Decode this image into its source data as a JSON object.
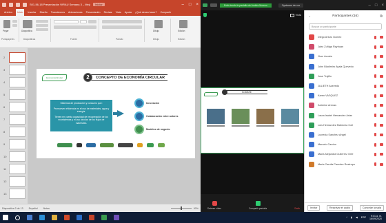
{
  "powerpoint": {
    "filename": "S01-56-18 Presentación WRAU Semana 3 – Mejor solo",
    "badge": "Iniciar",
    "tabs": [
      "Archivo",
      "Inicio",
      "Insertar",
      "Diseño",
      "Transiciones",
      "Animaciones",
      "Presentación",
      "Revisar",
      "Vista",
      "Ayuda",
      "¿Qué desea hacer?",
      "Compartir"
    ],
    "ribbon_groups": [
      "Portapapeles",
      "Diapositivas",
      "Fuente",
      "Párrafo",
      "Dibujo",
      "Edición"
    ],
    "ribbon_buttons": {
      "paste": "Pegar",
      "new_slide": "Diapositiva",
      "draw": "Dibujo",
      "edit": "Edición"
    },
    "slide_numbers": [
      "2",
      "3",
      "4",
      "5",
      "6",
      "7",
      "8",
      "9",
      "10",
      "11",
      "12",
      "13"
    ],
    "selected_slide": "2",
    "status": {
      "slide_info": "Diapositiva 2 de 13",
      "language": "Español",
      "notes": "Notas",
      "zoom": "90%"
    }
  },
  "slide": {
    "number": "2",
    "title": "CONCEPTO DE ECONOMÍA CIRCULAR",
    "logo_text": "EconomíaCircular",
    "box_paragraphs": [
      "Sistemas de producción y consumo que:",
      "Promueven eficiencia en el uso de materiales, agua y energía.",
      "Tienen en cuenta capacidad de recuperación de los ecosistemas y el uso circular de los flujos de materiales."
    ],
    "items": [
      "Innovación",
      "Colaboración entre actores",
      "Modelos de negocio"
    ],
    "logos": [
      "MINAMBIENTE",
      "Gobierno",
      "ANDI",
      "CECODES",
      "adidas",
      "Estrella",
      "Logo 7",
      "Logo 8"
    ]
  },
  "zoom": {
    "title_banner": "Está viendo la pantalla de Andrés Moreno",
    "title_button": "Opciones de ver",
    "view_label": "Vista",
    "share_title": "NOMBRE",
    "toolbar": [
      "Detener vídeo",
      "Seguridad",
      "Participantes",
      "Chat",
      "Compartir pantalla",
      "Grabar",
      "Reacciones",
      "Salir"
    ]
  },
  "participants": {
    "header": "Participantes (16)",
    "search_placeholder": "Buscar un participante",
    "list": [
      {
        "name": "Diego Arturo Gomez",
        "color": "#e24848"
      },
      {
        "name": "Jairo Zuñiga Rayhuan",
        "color": "#d04a6a"
      },
      {
        "name": "Jhon Acosta",
        "color": "#3a6fd0"
      },
      {
        "name": "John Bladimiro Ayala Quevedo",
        "color": "#3a6fd0"
      },
      {
        "name": "Jose Trujillo",
        "color": "#2f9e59"
      },
      {
        "name": "JULIETH Acevedo",
        "color": "#3a6fd0"
      },
      {
        "name": "Karen VASQUEZ",
        "color": "#3a6fd0"
      },
      {
        "name": "Katerine Arenas",
        "color": "#d04a6a"
      },
      {
        "name": "Laura Isabel Hernandez Arias",
        "color": "#2f9e59"
      },
      {
        "name": "Luis Hernandez Mahecha Coll",
        "color": "#2f9e59"
      },
      {
        "name": "Lucrecia Sanchez Angel",
        "color": "#3a6fd0"
      },
      {
        "name": "Marcelo Carrion",
        "color": "#3a6fd0"
      },
      {
        "name": "Maria Alejandra Gutierrez Orte",
        "color": "#3a6fd0"
      },
      {
        "name": "Maria Camila Paredes Restrepo",
        "color": "#d07a2a"
      }
    ],
    "footer": [
      "Invitar",
      "Reactivar el audio",
      "Cancelar la sala"
    ]
  },
  "taskbar": {
    "time": "9:41 a. m.",
    "date": "16/09/2020",
    "lang": "ESP"
  }
}
